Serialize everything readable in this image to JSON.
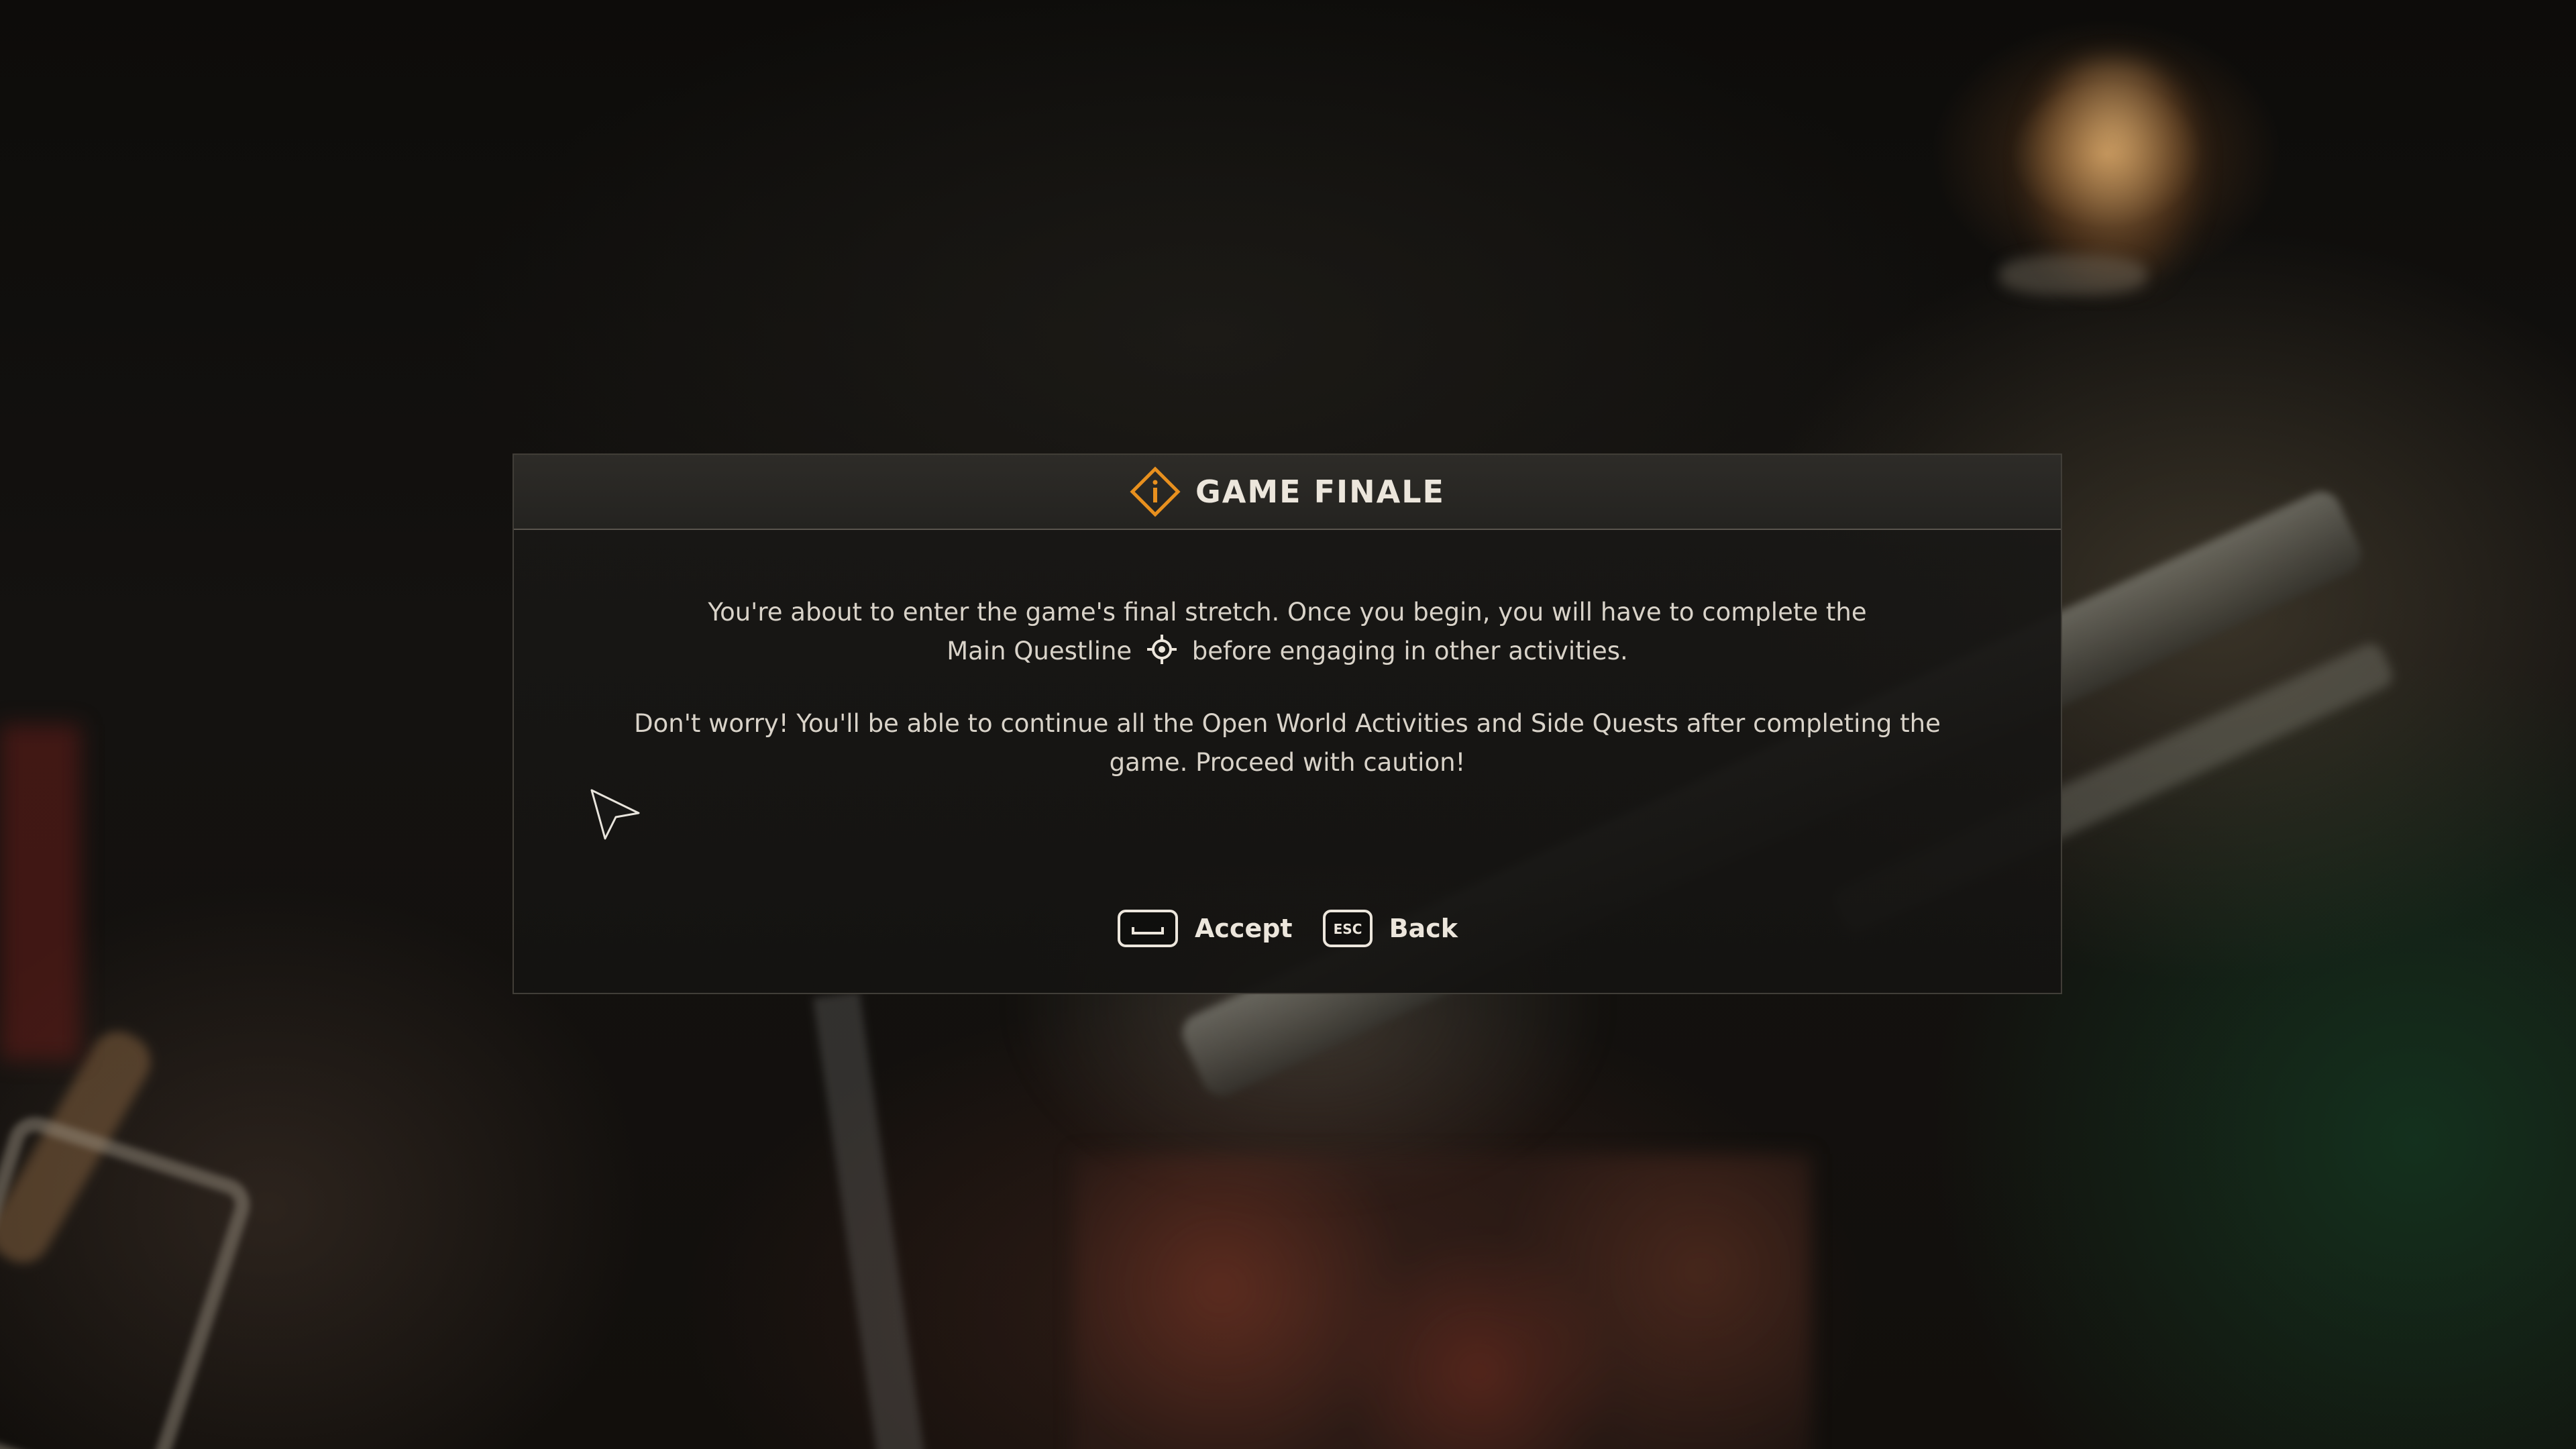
{
  "modal": {
    "title": "GAME FINALE",
    "icon": "info-diamond-icon",
    "accent_color": "#e8901e",
    "paragraph1_before_icon": "You're about to enter the game's final stretch. Once you begin, you will have to complete the Main Questline",
    "paragraph1_icon": "main-quest-target-icon",
    "paragraph1_after_icon": "before engaging in other activities.",
    "paragraph2": "Don't worry! You'll be able to continue all the Open World Activities and Side Quests after completing the game. Proceed with caution!"
  },
  "actions": {
    "accept": {
      "key_icon": "spacebar-key-icon",
      "label": "Accept"
    },
    "back": {
      "key_label": "ESC",
      "label": "Back"
    }
  }
}
